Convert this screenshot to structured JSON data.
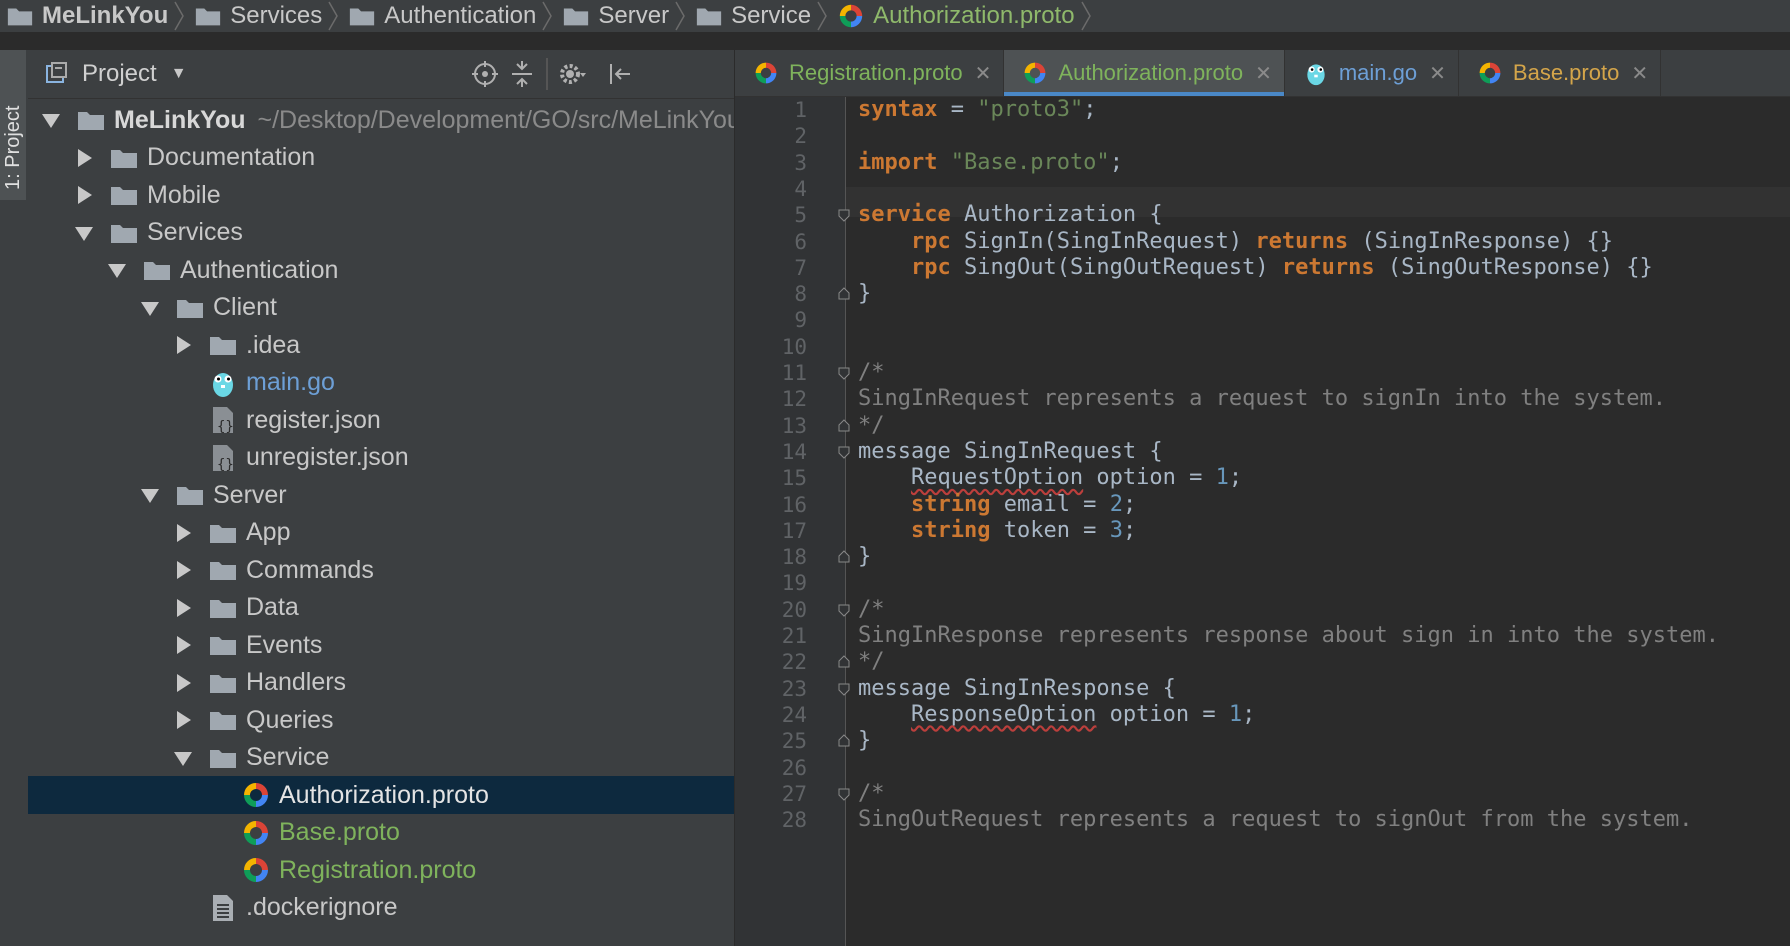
{
  "breadcrumb": {
    "items": [
      {
        "label": "MeLinkYou",
        "icon": "folder-icon"
      },
      {
        "label": "Services",
        "icon": "folder-icon"
      },
      {
        "label": "Authentication",
        "icon": "folder-icon"
      },
      {
        "label": "Server",
        "icon": "folder-icon"
      },
      {
        "label": "Service",
        "icon": "folder-icon"
      },
      {
        "label": "Authorization.proto",
        "icon": "proto-file-icon"
      }
    ]
  },
  "tool_stripe": {
    "project_tab": "1: Project"
  },
  "project_panel": {
    "title": "Project",
    "tree": [
      {
        "label": "MeLinkYou",
        "path": "~/Desktop/Development/GO/src/MeLinkYou",
        "type": "folder",
        "expanded": true
      },
      {
        "label": "Documentation",
        "type": "folder",
        "expanded": false
      },
      {
        "label": "Mobile",
        "type": "folder",
        "expanded": false
      },
      {
        "label": "Services",
        "type": "folder",
        "expanded": true
      },
      {
        "label": "Authentication",
        "type": "folder",
        "expanded": true
      },
      {
        "label": "Client",
        "type": "folder",
        "expanded": true
      },
      {
        "label": ".idea",
        "type": "folder",
        "expanded": false
      },
      {
        "label": "main.go",
        "type": "go"
      },
      {
        "label": "register.json",
        "type": "json"
      },
      {
        "label": "unregister.json",
        "type": "json"
      },
      {
        "label": "Server",
        "type": "folder",
        "expanded": true
      },
      {
        "label": "App",
        "type": "folder",
        "expanded": false
      },
      {
        "label": "Commands",
        "type": "folder",
        "expanded": false
      },
      {
        "label": "Data",
        "type": "folder",
        "expanded": false
      },
      {
        "label": "Events",
        "type": "folder",
        "expanded": false
      },
      {
        "label": "Handlers",
        "type": "folder",
        "expanded": false
      },
      {
        "label": "Queries",
        "type": "folder",
        "expanded": false
      },
      {
        "label": "Service",
        "type": "folder",
        "expanded": true
      },
      {
        "label": "Authorization.proto",
        "type": "proto",
        "selected": true
      },
      {
        "label": "Base.proto",
        "type": "proto"
      },
      {
        "label": "Registration.proto",
        "type": "proto"
      },
      {
        "label": ".dockerignore",
        "type": "text"
      }
    ]
  },
  "editor_tabs": [
    {
      "label": "Registration.proto",
      "icon": "proto-file-icon"
    },
    {
      "label": "Authorization.proto",
      "icon": "proto-file-icon",
      "active": true
    },
    {
      "label": "main.go",
      "icon": "gopher-icon"
    },
    {
      "label": "Base.proto",
      "icon": "proto-file-icon"
    }
  ],
  "editor": {
    "line_numbers": [
      "1",
      "2",
      "3",
      "4",
      "5",
      "6",
      "7",
      "8",
      "9",
      "10",
      "11",
      "12",
      "13",
      "14",
      "15",
      "16",
      "17",
      "18",
      "19",
      "20",
      "21",
      "22",
      "23",
      "24",
      "25",
      "26",
      "27",
      "28"
    ],
    "lines": [
      [
        [
          "kw",
          "syntax"
        ],
        [
          "p",
          " = "
        ],
        [
          "str",
          "\"proto3\""
        ],
        [
          "p",
          ";"
        ]
      ],
      [],
      [
        [
          "kw",
          "import"
        ],
        [
          "p",
          " "
        ],
        [
          "str",
          "\"Base.proto\""
        ],
        [
          "p",
          ";"
        ]
      ],
      [],
      [
        [
          "kw",
          "service"
        ],
        [
          "p",
          " Authorization {"
        ]
      ],
      [
        [
          "p",
          "    "
        ],
        [
          "kw",
          "rpc"
        ],
        [
          "p",
          " SignIn(SingInRequest) "
        ],
        [
          "kw",
          "returns"
        ],
        [
          "p",
          " (SingInResponse) {}"
        ]
      ],
      [
        [
          "p",
          "    "
        ],
        [
          "kw",
          "rpc"
        ],
        [
          "p",
          " SingOut(SingOutRequest) "
        ],
        [
          "kw",
          "returns"
        ],
        [
          "p",
          " (SingOutResponse) {}"
        ]
      ],
      [
        [
          "p",
          "}"
        ]
      ],
      [],
      [],
      [
        [
          "cmt",
          "/*"
        ]
      ],
      [
        [
          "cmt",
          "SingInRequest represents a request to signIn into the system."
        ]
      ],
      [
        [
          "cmt",
          "*/"
        ]
      ],
      [
        [
          "p",
          "message SingInRequest {"
        ]
      ],
      [
        [
          "p",
          "    "
        ],
        [
          "sq",
          "RequestOption"
        ],
        [
          "p",
          " option = "
        ],
        [
          "num",
          "1"
        ],
        [
          "p",
          ";"
        ]
      ],
      [
        [
          "p",
          "    "
        ],
        [
          "kw",
          "string"
        ],
        [
          "p",
          " email = "
        ],
        [
          "num",
          "2"
        ],
        [
          "p",
          ";"
        ]
      ],
      [
        [
          "p",
          "    "
        ],
        [
          "kw",
          "string"
        ],
        [
          "p",
          " token = "
        ],
        [
          "num",
          "3"
        ],
        [
          "p",
          ";"
        ]
      ],
      [
        [
          "p",
          "}"
        ]
      ],
      [],
      [
        [
          "cmt",
          "/*"
        ]
      ],
      [
        [
          "cmt",
          "SingInResponse represents response about sign in into the system."
        ]
      ],
      [
        [
          "cmt",
          "*/"
        ]
      ],
      [
        [
          "p",
          "message SingInResponse {"
        ]
      ],
      [
        [
          "p",
          "    "
        ],
        [
          "sq",
          "ResponseOption"
        ],
        [
          "p",
          " option = "
        ],
        [
          "num",
          "1"
        ],
        [
          "p",
          ";"
        ]
      ],
      [
        [
          "p",
          "}"
        ]
      ],
      [],
      [
        [
          "cmt",
          "/*"
        ]
      ],
      [
        [
          "cmt",
          "SingOutRequest represents a request to signOut from the system."
        ]
      ]
    ]
  },
  "colors": {
    "accent": "#4a88c7",
    "selection": "#0d293e",
    "keyword": "#cc7832",
    "string": "#6a8759",
    "number": "#6897bb",
    "comment": "#808080"
  }
}
